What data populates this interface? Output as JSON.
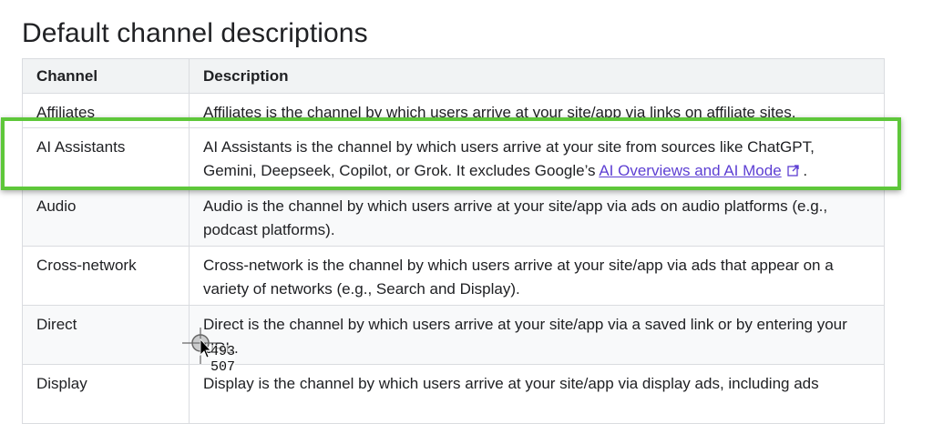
{
  "title": "Default channel descriptions",
  "table": {
    "headers": {
      "channel": "Channel",
      "description": "Description"
    },
    "rows": [
      {
        "channel": "Affiliates",
        "description": "Affiliates is the channel by which users arrive at your site/app via links on affiliate sites."
      },
      {
        "channel": "AI Assistants",
        "description_before": "AI Assistants is the channel by which users arrive at your site from sources like ChatGPT, Gemini, Deepseek, Copilot, or Grok. It excludes Google’s ",
        "link_text": "AI Overviews and AI Mode",
        "description_after": " ."
      },
      {
        "channel": "Audio",
        "description": "Audio is the channel by which users arrive at your site/app via ads on audio platforms (e.g., podcast platforms)."
      },
      {
        "channel": "Cross-network",
        "description": "Cross-network is the channel by which users arrive at your site/app via ads that appear on a variety of networks (e.g., Search and Display)."
      },
      {
        "channel": "Direct",
        "description": "Direct is the channel by which users arrive at your site/app via a saved link or by entering your URL."
      },
      {
        "channel": "Display",
        "description": "Display is the channel by which users arrive at your site/app via display ads, including ads"
      }
    ]
  },
  "cursor": {
    "x_readout": "493",
    "y_readout": "507"
  },
  "colors": {
    "highlight": "#5ec73a",
    "link": "#5d3fd3",
    "header_bg": "#f1f3f4"
  },
  "icons": {
    "external_link": "external-link-icon",
    "cursor": "crosshair-cursor-icon"
  }
}
